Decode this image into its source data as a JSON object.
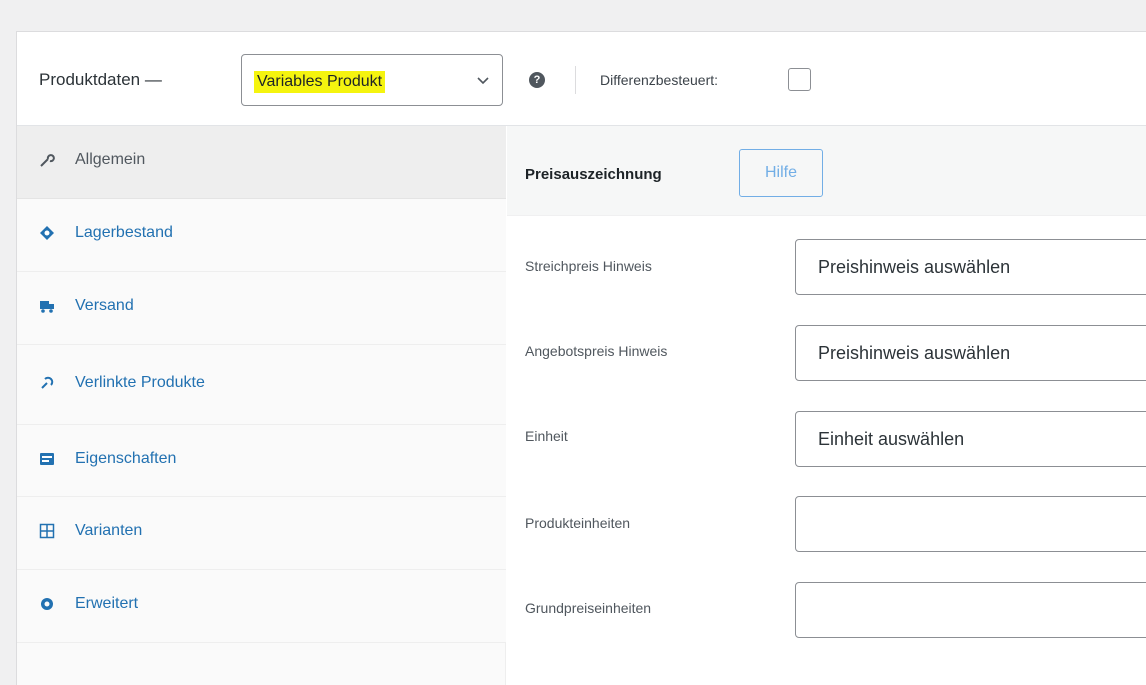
{
  "header": {
    "title": "Produktdaten —",
    "product_type": "Variables Produkt",
    "help_icon": "question-circle-icon",
    "diff_label": "Differenzbesteuert:",
    "diff_checked": false
  },
  "tabs": [
    {
      "label": "Allgemein",
      "icon": "wrench-icon",
      "active": true
    },
    {
      "label": "Lagerbestand",
      "icon": "stock-icon",
      "active": false
    },
    {
      "label": "Versand",
      "icon": "truck-icon",
      "active": false
    },
    {
      "label": "Verlinkte Produkte",
      "icon": "link-icon",
      "active": false
    },
    {
      "label": "Eigenschaften",
      "icon": "list-icon",
      "active": false
    },
    {
      "label": "Varianten",
      "icon": "grid-icon",
      "active": false
    },
    {
      "label": "Erweitert",
      "icon": "gear-icon",
      "active": false
    }
  ],
  "section": {
    "title": "Preisauszeichnung",
    "help_button": "Hilfe"
  },
  "fields": [
    {
      "label": "Streichpreis Hinweis",
      "value": "Preishinweis auswählen"
    },
    {
      "label": "Angebotspreis Hinweis",
      "value": "Preishinweis auswählen"
    },
    {
      "label": "Einheit",
      "value": "Einheit auswählen"
    },
    {
      "label": "Produkteinheiten",
      "value": ""
    },
    {
      "label": "Grundpreiseinheiten",
      "value": ""
    }
  ],
  "colors": {
    "accent": "#2271b1",
    "highlight": "#f5f40f",
    "help_button": "#72aee6"
  }
}
